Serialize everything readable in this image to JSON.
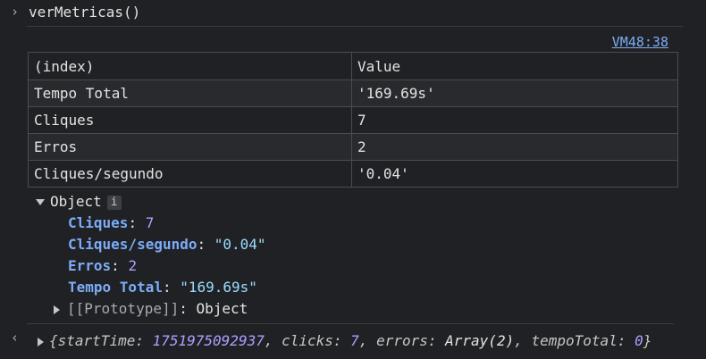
{
  "command": {
    "prompt_icon": "chevron-right",
    "text": "verMetricas()"
  },
  "source_link": "VM48:38",
  "table": {
    "headers": [
      "(index)",
      "Value"
    ],
    "rows": [
      {
        "index": "Tempo Total",
        "value": "'169.69s'",
        "type": "string"
      },
      {
        "index": "Cliques",
        "value": "7",
        "type": "number"
      },
      {
        "index": "Erros",
        "value": "2",
        "type": "number"
      },
      {
        "index": "Cliques/segundo",
        "value": "'0.04'",
        "type": "string"
      }
    ]
  },
  "object_view": {
    "label": "Object",
    "info_badge": "i",
    "props": [
      {
        "key": "Cliques",
        "value": "7",
        "type": "number"
      },
      {
        "key": "Cliques/segundo",
        "value": "\"0.04\"",
        "type": "string"
      },
      {
        "key": "Erros",
        "value": "2",
        "type": "number"
      },
      {
        "key": "Tempo Total",
        "value": "\"169.69s\"",
        "type": "string"
      }
    ],
    "prototype": {
      "key": "[[Prototype]]",
      "value": "Object"
    }
  },
  "return_value": {
    "open": "{",
    "startTime_key": "startTime",
    "startTime_val": "1751975092937",
    "clicks_key": "clicks",
    "clicks_val": "7",
    "errors_key": "errors",
    "errors_val": "Array(2)",
    "tempo_key": "tempoTotal",
    "tempo_val": "0",
    "close": "}"
  },
  "colors": {
    "background": "#202124",
    "string": "#79b8ff",
    "number": "#a8a1ff",
    "key": "#7cacf8"
  }
}
